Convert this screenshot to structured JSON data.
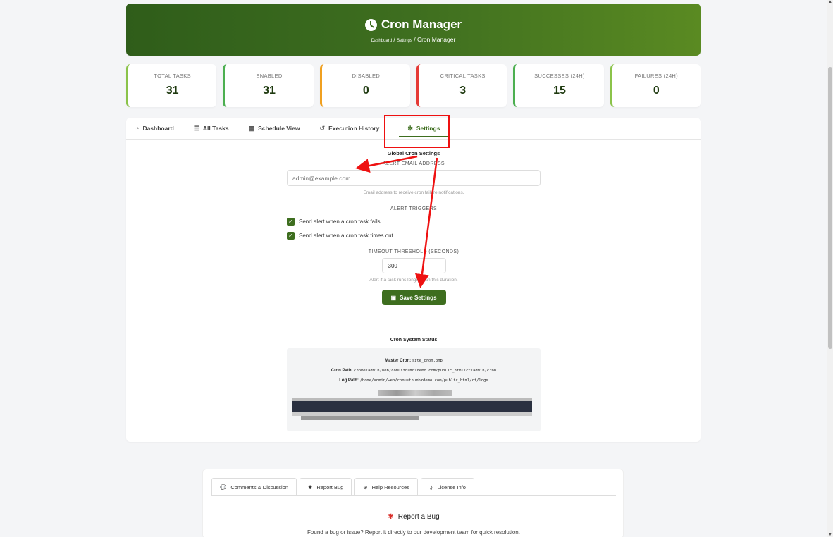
{
  "header": {
    "title": "Cron Manager",
    "crumb_dashboard": "Dashboard",
    "crumb_settings": "Settings",
    "crumb_current": "Cron Manager"
  },
  "stats": [
    {
      "label": "TOTAL TASKS",
      "value": "31",
      "color": "#8bc34a"
    },
    {
      "label": "ENABLED",
      "value": "31",
      "color": "#4caf50"
    },
    {
      "label": "DISABLED",
      "value": "0",
      "color": "#f0a020"
    },
    {
      "label": "CRITICAL TASKS",
      "value": "3",
      "color": "#e53935"
    },
    {
      "label": "SUCCESSES (24H)",
      "value": "15",
      "color": "#4caf50"
    },
    {
      "label": "FAILURES (24H)",
      "value": "0",
      "color": "#8bc34a"
    }
  ],
  "tabs": [
    {
      "label": "Dashboard",
      "icon": "dashboard-icon"
    },
    {
      "label": "All Tasks",
      "icon": "list-icon"
    },
    {
      "label": "Schedule View",
      "icon": "calendar-icon"
    },
    {
      "label": "Execution History",
      "icon": "history-icon"
    },
    {
      "label": "Settings",
      "icon": "gear-icon"
    }
  ],
  "form": {
    "title": "Global Cron Settings",
    "email_label": "ALERT EMAIL ADDRESS",
    "email_placeholder": "admin@example.com",
    "email_hint": "Email address to receive cron failure notifications.",
    "triggers_label": "ALERT TRIGGERS",
    "trigger_fail": "Send alert when a cron task fails",
    "trigger_timeout": "Send alert when a cron task times out",
    "timeout_label": "TIMEOUT THRESHOLD (SECONDS)",
    "timeout_value": "300",
    "timeout_hint": "Alert if a task runs longer than this duration.",
    "save_label": "Save Settings"
  },
  "status": {
    "title": "Cron System Status",
    "master_label": "Master Cron:",
    "master_value": "site_cron.php",
    "cron_path_label": "Cron Path:",
    "cron_path_value": "/home/admin/web/comusthumbzdemo.com/public_html/ct/admin/cron",
    "log_path_label": "Log Path:",
    "log_path_value": "/home/admin/web/comusthumbzdemo.com/public_html/ct/logs"
  },
  "footer": {
    "tabs": [
      {
        "label": "Comments & Discussion",
        "icon": "comments-icon"
      },
      {
        "label": "Report Bug",
        "icon": "bug-icon"
      },
      {
        "label": "Help Resources",
        "icon": "help-icon"
      },
      {
        "label": "License Info",
        "icon": "key-icon"
      }
    ],
    "title": "Report a Bug",
    "description": "Found a bug or issue? Report it directly to our development team for quick resolution."
  },
  "colors": {
    "brand": "#3e6e1f",
    "annotation": "#e11"
  }
}
